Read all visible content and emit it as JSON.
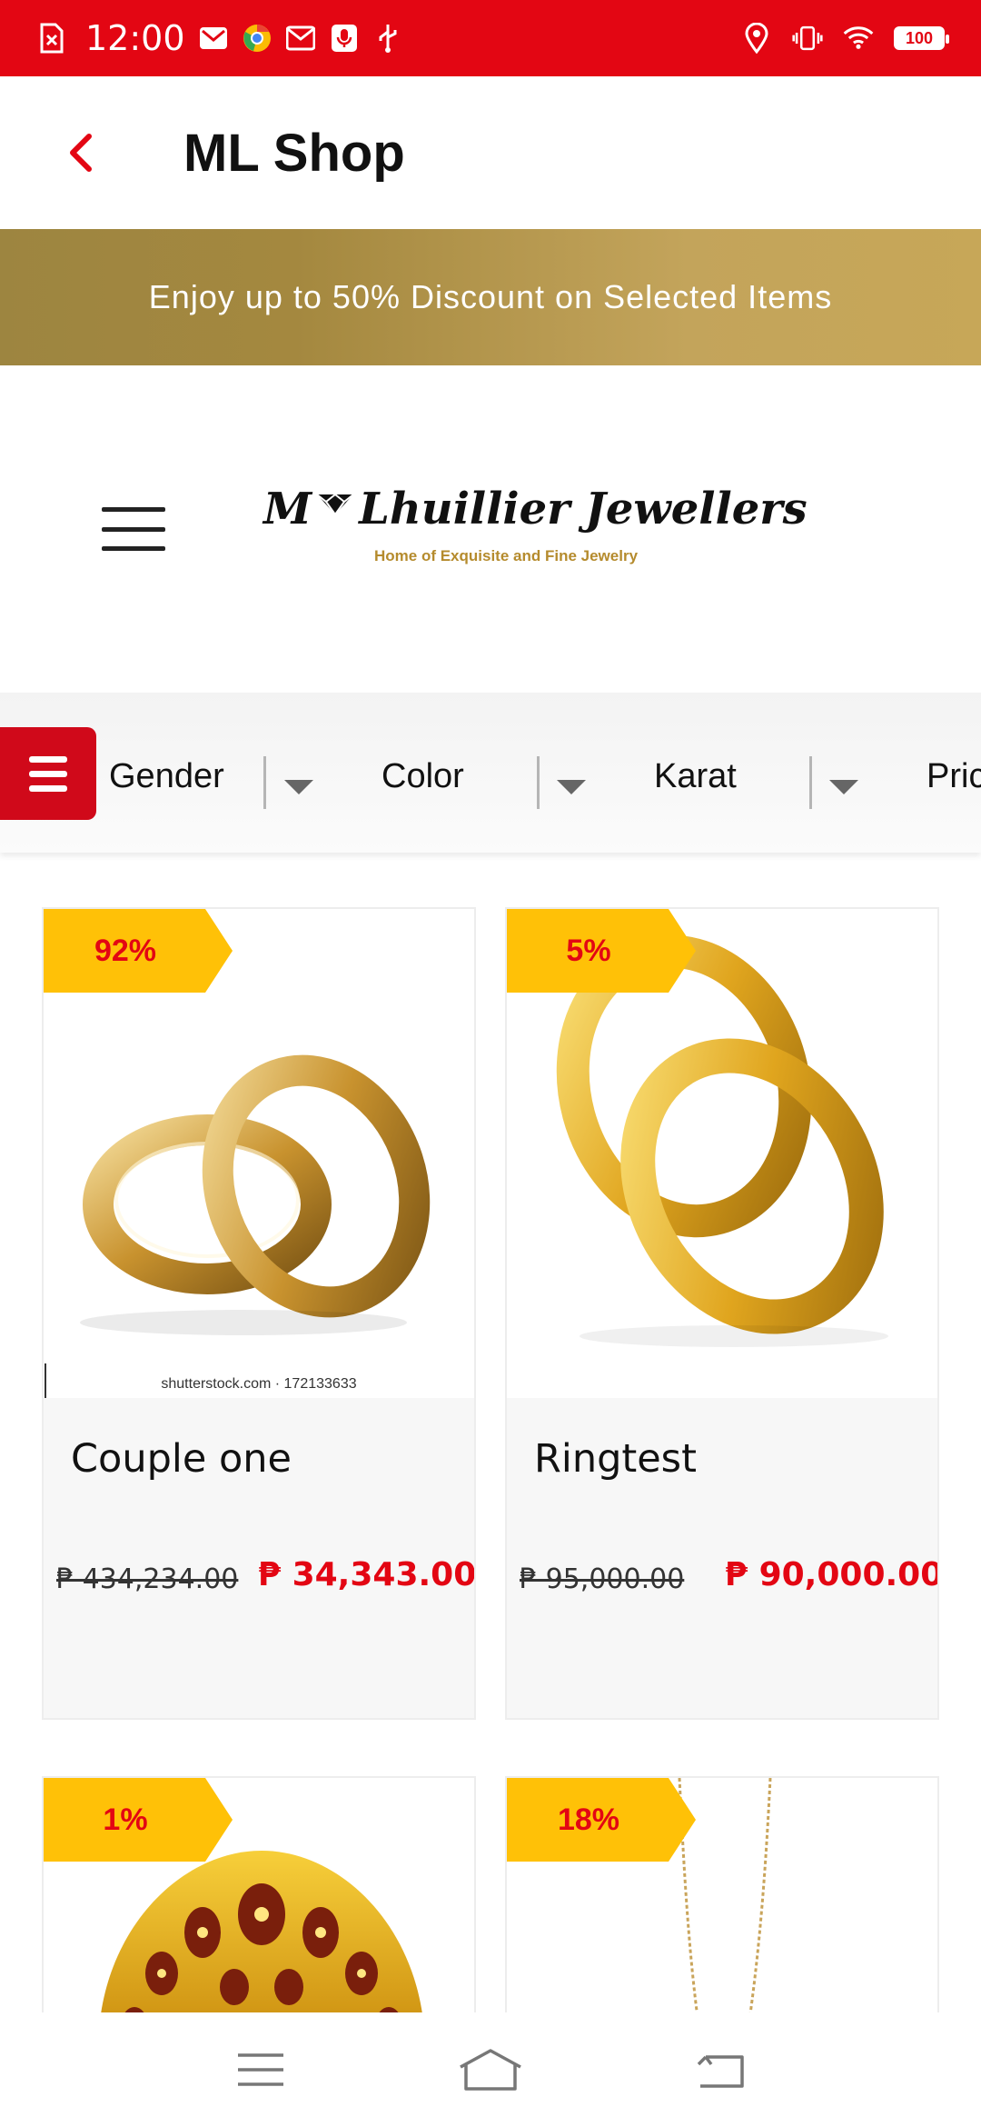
{
  "status_bar": {
    "time": "12:00",
    "battery": "100",
    "left_icons": [
      "sim-alert-icon",
      "mail-icon",
      "chrome-icon",
      "gmail-icon",
      "mic-icon",
      "usb-icon"
    ],
    "right_icons": [
      "location-icon",
      "vibrate-icon",
      "wifi-icon",
      "battery-icon"
    ],
    "color": "#e30613"
  },
  "app_bar": {
    "title": "ML Shop"
  },
  "promo": {
    "text": "Enjoy up to 50% Discount on Selected Items"
  },
  "brand": {
    "logo_script_left": "M",
    "logo_script_right": "Lhuillier Jewellers",
    "logo_tagline": "Home of Exquisite and Fine Jewelry"
  },
  "filters": [
    {
      "label": "Gender"
    },
    {
      "label": "Color"
    },
    {
      "label": "Karat"
    },
    {
      "label": "Pric"
    }
  ],
  "products": [
    {
      "name": "Couple one",
      "discount": "92%",
      "old_price": "₱ 434,234.00",
      "new_price": "₱ 34,343.00",
      "watermark": "shutterstock.com · 172133633"
    },
    {
      "name": "Ringtest",
      "discount": "5%",
      "old_price": "₱ 95,000.00",
      "new_price": "₱ 90,000.00"
    },
    {
      "name": "",
      "discount": "1%"
    },
    {
      "name": "",
      "discount": "18%"
    }
  ],
  "colors": {
    "accent_red": "#e30613",
    "badge_yellow": "#ffc107",
    "gold": "#b58b2d"
  }
}
